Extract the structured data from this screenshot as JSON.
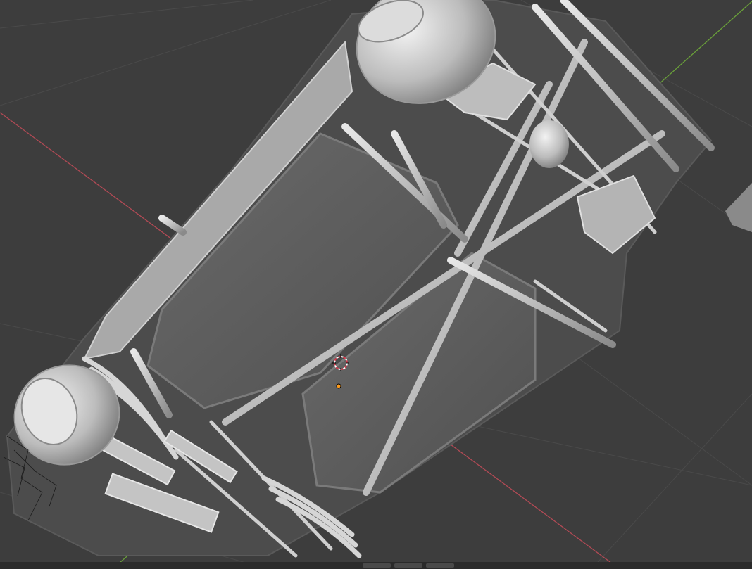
{
  "app": "3D Viewport",
  "viewport": {
    "background": "#3d3d3d",
    "grid_color": "#4a4a4a",
    "axis_x_color": "#b24a55",
    "axis_y_color": "#6aa03a",
    "origin_marker_color": "#ff9b1a",
    "cursor_colors": [
      "#d8374a",
      "#ffffff"
    ]
  },
  "model": {
    "kind": "vehicle-chassis-underside",
    "material_color": "#c9c9c9"
  },
  "icons": {
    "cursor": "3d-cursor-icon",
    "origin": "object-origin-icon"
  }
}
